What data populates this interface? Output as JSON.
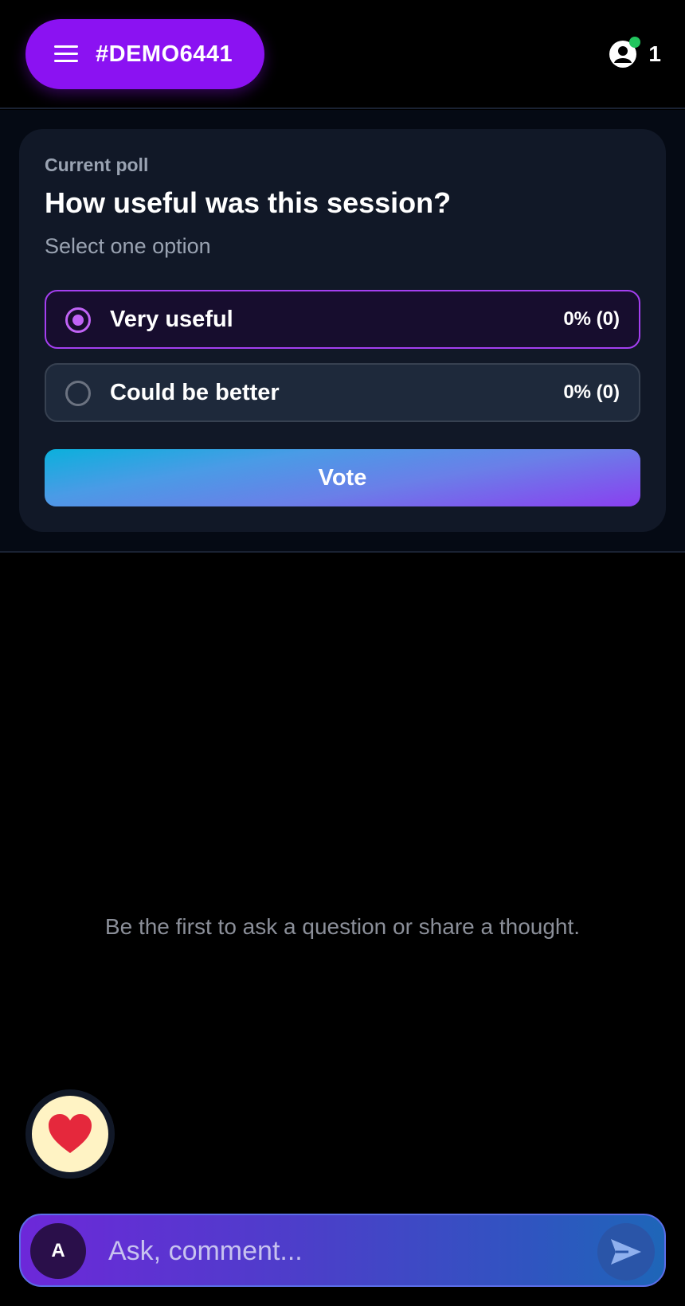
{
  "header": {
    "room_code": "#DEMO6441",
    "participant_count": "1",
    "accent_color": "#8b12f2",
    "online_color": "#22c55e"
  },
  "poll": {
    "label": "Current poll",
    "question": "How useful was this session?",
    "hint": "Select one option",
    "options": [
      {
        "label": "Very useful",
        "result": "0% (0)",
        "selected": true
      },
      {
        "label": "Could be better",
        "result": "0% (0)",
        "selected": false
      }
    ],
    "vote_label": "Vote"
  },
  "feed": {
    "empty_message": "Be the first to ask a question or share a thought."
  },
  "reaction": {
    "icon": "heart-icon",
    "color": "#e5283c"
  },
  "composer": {
    "avatar_initial": "A",
    "placeholder": "Ask, comment...",
    "send_icon": "send-icon"
  }
}
